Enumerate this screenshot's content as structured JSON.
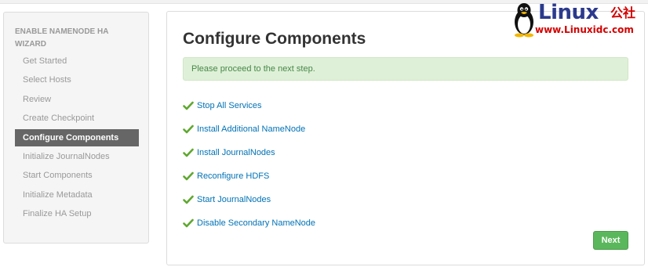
{
  "sidebar": {
    "title": "ENABLE NAMENODE HA WIZARD",
    "steps": [
      {
        "label": "Get Started"
      },
      {
        "label": "Select Hosts"
      },
      {
        "label": "Review"
      },
      {
        "label": "Create Checkpoint"
      },
      {
        "label": "Configure Components",
        "active": true
      },
      {
        "label": "Initialize JournalNodes"
      },
      {
        "label": "Start Components"
      },
      {
        "label": "Initialize Metadata"
      },
      {
        "label": "Finalize HA Setup"
      }
    ]
  },
  "main": {
    "title": "Configure Components",
    "alert": "Please proceed to the next step.",
    "tasks": [
      {
        "label": "Stop All Services",
        "status": "done"
      },
      {
        "label": "Install Additional NameNode",
        "status": "done"
      },
      {
        "label": "Install JournalNodes",
        "status": "done"
      },
      {
        "label": "Reconfigure HDFS",
        "status": "done"
      },
      {
        "label": "Start JournalNodes",
        "status": "done"
      },
      {
        "label": "Disable Secondary NameNode",
        "status": "done"
      }
    ],
    "next_label": "Next"
  },
  "watermark": {
    "word": "Linux",
    "cjk": "公社",
    "url": "www.Linuxidc.com"
  },
  "colors": {
    "accent_link": "#0072b5",
    "check_green": "#5fa82f",
    "alert_bg": "#dff0d8",
    "next_button": "#5bb75b",
    "active_step_bg": "#666666"
  }
}
